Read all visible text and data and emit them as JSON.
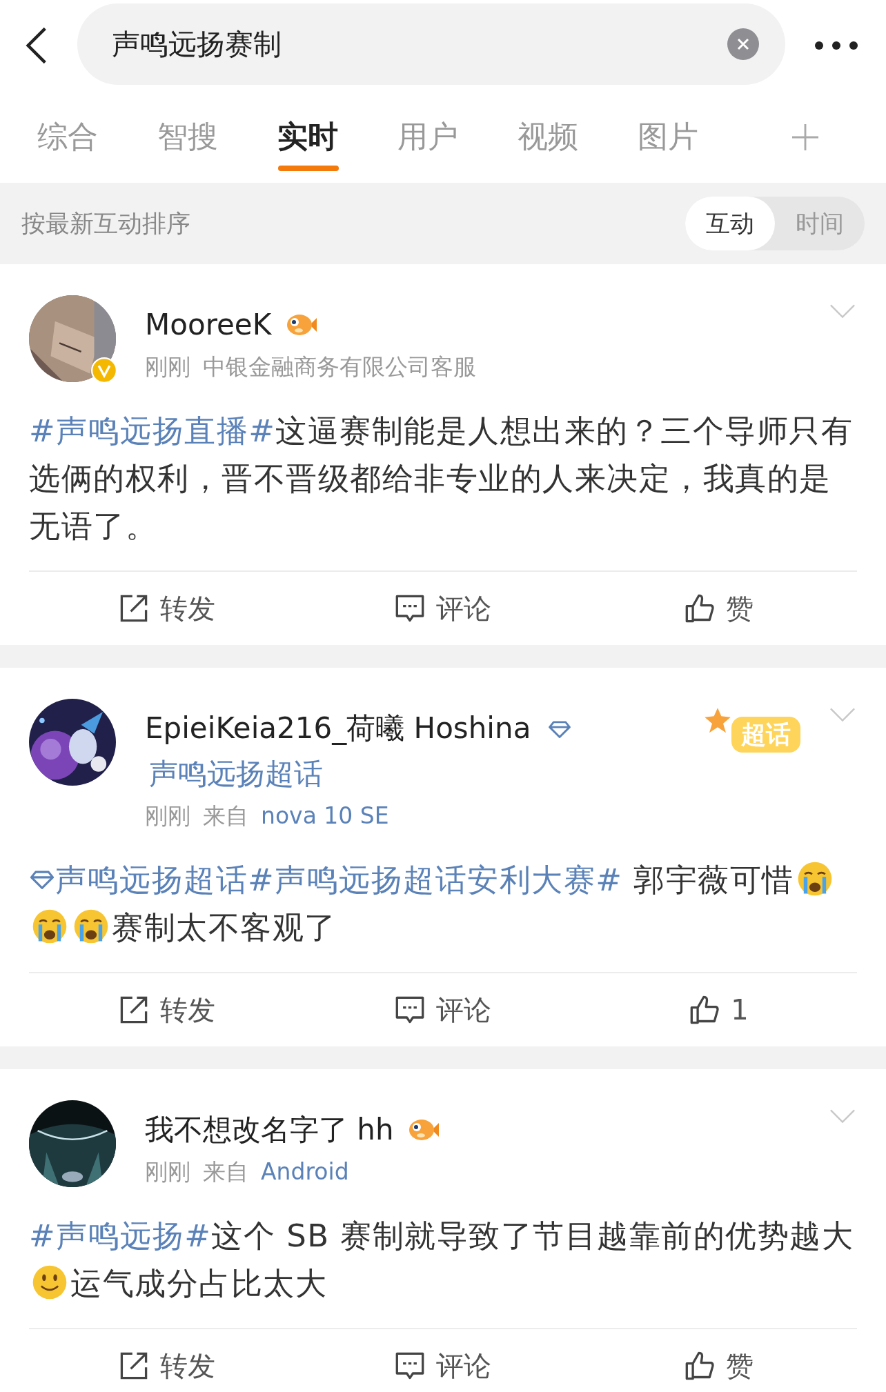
{
  "search": {
    "query": "声鸣远扬赛制"
  },
  "tabs": [
    {
      "label": "综合",
      "selected": false
    },
    {
      "label": "智搜",
      "selected": false
    },
    {
      "label": "实时",
      "selected": true
    },
    {
      "label": "用户",
      "selected": false
    },
    {
      "label": "视频",
      "selected": false
    },
    {
      "label": "图片",
      "selected": false
    }
  ],
  "sort": {
    "label": "按最新互动排序",
    "options": [
      {
        "label": "互动",
        "selected": true
      },
      {
        "label": "时间",
        "selected": false
      }
    ]
  },
  "posts": [
    {
      "name": "MooreeK",
      "vip": true,
      "verified": true,
      "time": "刚刚",
      "source": "中银金融商务有限公司客服",
      "source_link": false,
      "content": [
        {
          "kind": "topic",
          "text": "#声鸣远扬直播#"
        },
        {
          "kind": "text",
          "text": "这逼赛制能是人想出来的？三个导师只有选俩的权利，晋不晋级都给非专业的人来决定，我真的是无语了。"
        }
      ],
      "actions": {
        "repost": "转发",
        "comment": "评论",
        "like": "赞"
      }
    },
    {
      "name": "EpieiKeia216_荷曦 Hoshina",
      "vip": false,
      "verified": false,
      "supertopic": "声鸣远扬超话",
      "badge": "超话",
      "time": "刚刚",
      "source_prefix": "来自",
      "source": "nova 10 SE",
      "source_link": true,
      "content": [
        {
          "kind": "supertopic",
          "text": "声鸣远扬超话"
        },
        {
          "kind": "topic",
          "text": "#声鸣远扬超话安利大赛#"
        },
        {
          "kind": "text",
          "text": " 郭宇薇可惜"
        },
        {
          "kind": "cry"
        },
        {
          "kind": "cry"
        },
        {
          "kind": "cry"
        },
        {
          "kind": "text",
          "text": "赛制太不客观了"
        }
      ],
      "actions": {
        "repost": "转发",
        "comment": "评论",
        "like": "1"
      }
    },
    {
      "name": "我不想改名字了 hh",
      "vip": true,
      "verified": false,
      "time": "刚刚",
      "source_prefix": "来自",
      "source": "Android",
      "source_link": true,
      "content": [
        {
          "kind": "topic",
          "text": "#声鸣远扬#"
        },
        {
          "kind": "text",
          "text": "这个 SB 赛制就导致了节目越靠前的优势越大"
        },
        {
          "kind": "smile"
        },
        {
          "kind": "text",
          "text": "运气成分占比太大"
        }
      ],
      "actions": {
        "repost": "转发",
        "comment": "评论",
        "like": "赞"
      }
    }
  ]
}
